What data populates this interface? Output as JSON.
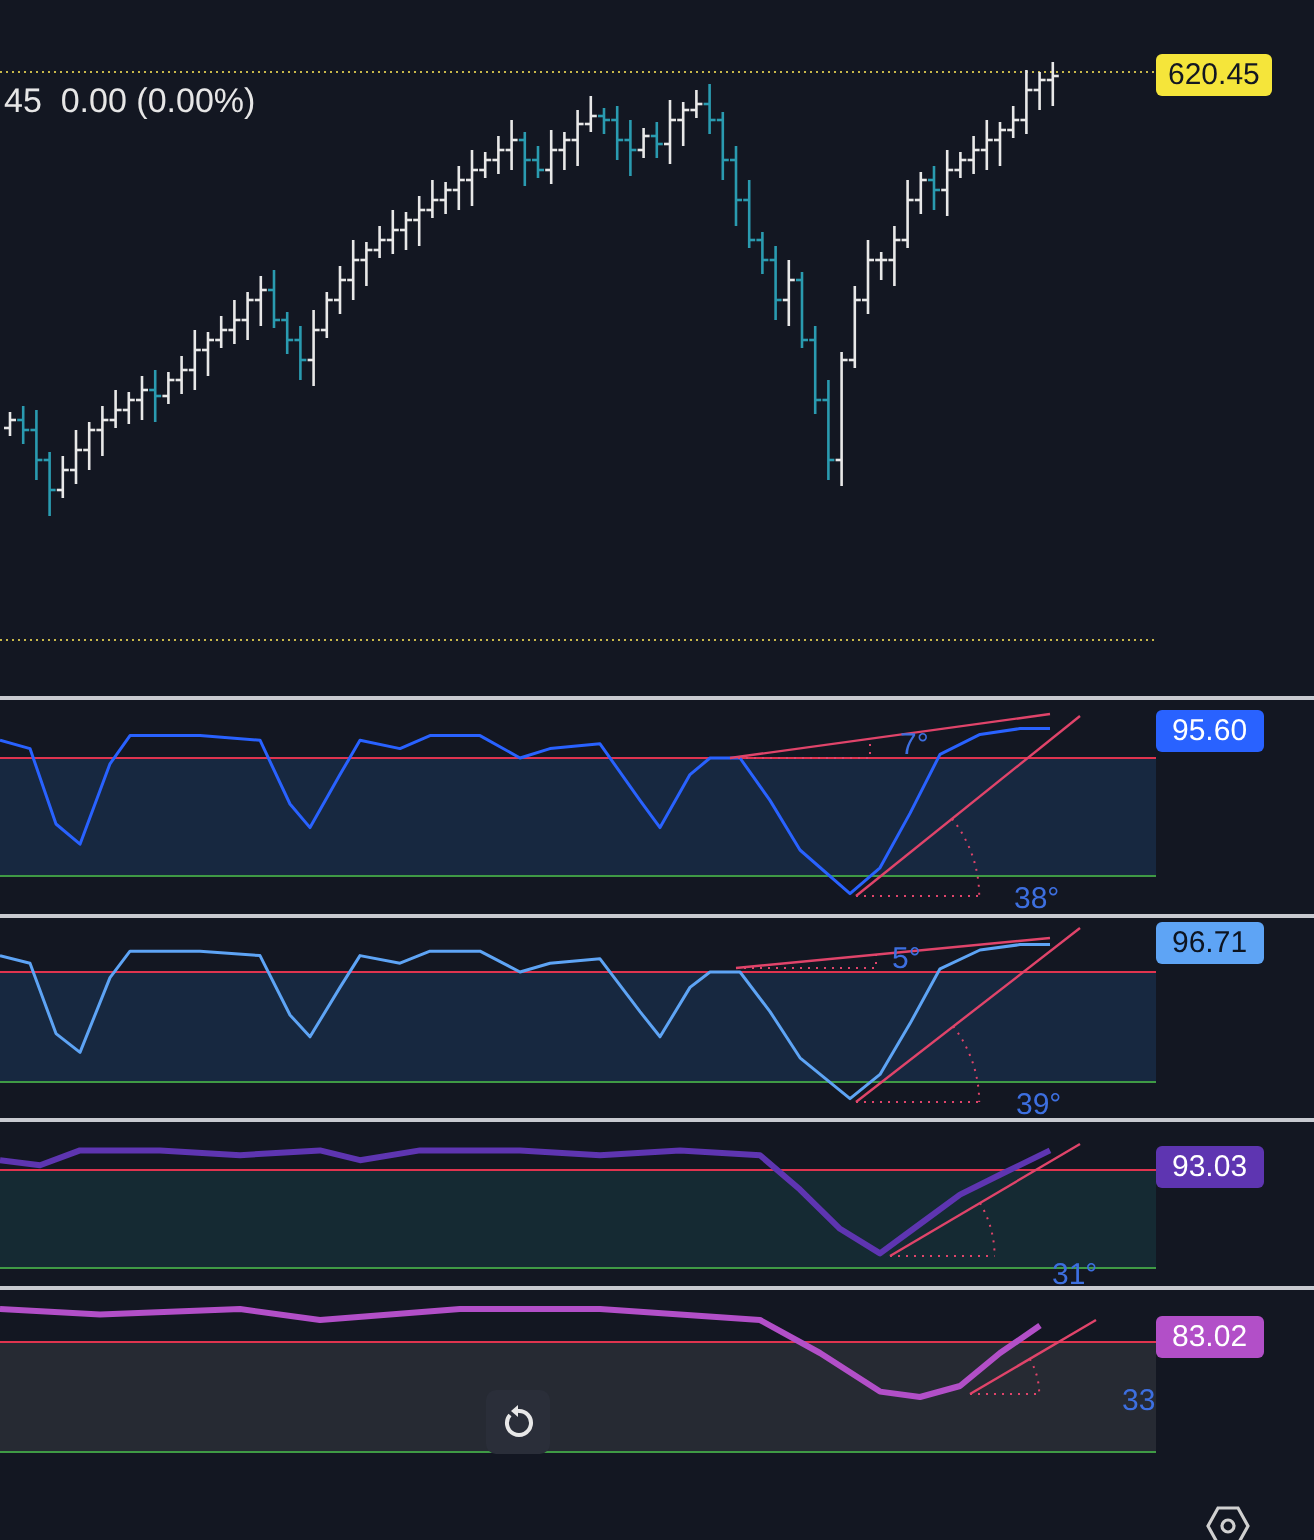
{
  "price_scale": {
    "last_price": "620.45"
  },
  "legend": {
    "text": "45  0.00 (0.00%)"
  },
  "oscillators": [
    {
      "value": "95.60",
      "color": "#2962ff",
      "angle_labels": [
        {
          "kind": "small",
          "text": "7°"
        },
        {
          "kind": "large",
          "text": "38°"
        }
      ]
    },
    {
      "value": "96.71",
      "color": "#5ea4f5",
      "angle_labels": [
        {
          "kind": "small",
          "text": "5°"
        },
        {
          "kind": "large",
          "text": "39°"
        }
      ]
    },
    {
      "value": "93.03",
      "color": "#5e35b1",
      "angle_labels": [
        {
          "kind": "large",
          "text": "31°"
        }
      ]
    },
    {
      "value": "83.02",
      "color": "#b24fc8",
      "angle_labels": [
        {
          "kind": "large",
          "text": "33"
        }
      ]
    }
  ]
}
